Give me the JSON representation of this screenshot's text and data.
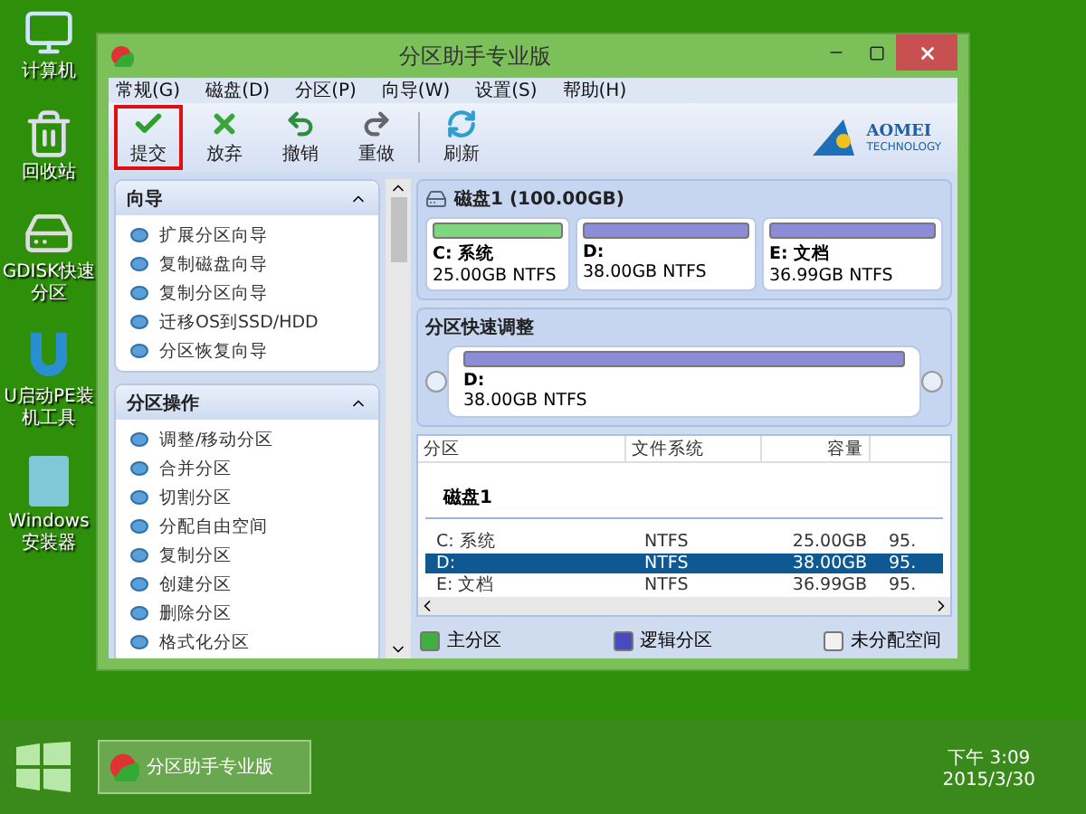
{
  "desktop_icons": [
    {
      "kind": "computer",
      "label": "计算机"
    },
    {
      "kind": "recycle",
      "label": "回收站"
    },
    {
      "kind": "gdisk",
      "label": "GDISK快速分区"
    },
    {
      "kind": "u",
      "label": "U启动PE装机工具"
    },
    {
      "kind": "windows",
      "label": "Windows安装器"
    }
  ],
  "window": {
    "title": "分区助手专业版",
    "menu": [
      "常规(G)",
      "磁盘(D)",
      "分区(P)",
      "向导(W)",
      "设置(S)",
      "帮助(H)"
    ],
    "toolbar": [
      {
        "kind": "check",
        "label": "提交",
        "selected": true
      },
      {
        "kind": "x",
        "label": "放弃",
        "selected": false
      },
      {
        "kind": "undo",
        "label": "撤销",
        "selected": false
      },
      {
        "kind": "redo",
        "label": "重做",
        "selected": false
      },
      {
        "kind": "refresh",
        "label": "刷新",
        "selected": false
      }
    ],
    "logo": {
      "name": "AOMEI",
      "tagline": "TECHNOLOGY"
    },
    "sidebar": [
      {
        "title": "向导",
        "expanded": true,
        "items": [
          "扩展分区向导",
          "复制磁盘向导",
          "复制分区向导",
          "迁移OS到SSD/HDD",
          "分区恢复向导"
        ]
      },
      {
        "title": "分区操作",
        "expanded": true,
        "items": [
          "调整/移动分区",
          "合并分区",
          "切割分区",
          "分配自由空间",
          "复制分区",
          "创建分区",
          "删除分区",
          "格式化分区"
        ]
      }
    ],
    "disk": {
      "title": "磁盘1 (100.00GB)",
      "partitions": [
        {
          "name": "C: 系统",
          "size": "25.00GB NTFS",
          "color": "#7fd67f"
        },
        {
          "name": "D:",
          "size": "38.00GB NTFS",
          "color": "#8c8cd8"
        },
        {
          "name": "E: 文档",
          "size": "36.99GB NTFS",
          "color": "#8c8cd8"
        }
      ]
    },
    "quick_adjust": {
      "title": "分区快速调整",
      "name": "D:",
      "size": "38.00GB NTFS"
    },
    "table": {
      "columns": [
        "分区",
        "文件系统",
        "容量"
      ],
      "group": "磁盘1",
      "rows": [
        {
          "cells": [
            "C: 系统",
            "NTFS",
            "25.00GB",
            "95."
          ],
          "selected": false
        },
        {
          "cells": [
            "D:",
            "NTFS",
            "38.00GB",
            "95."
          ],
          "selected": true
        },
        {
          "cells": [
            "E: 文档",
            "NTFS",
            "36.99GB",
            "95."
          ],
          "selected": false
        }
      ]
    },
    "legend": [
      {
        "label": "主分区",
        "color": "#3fb03f"
      },
      {
        "label": "逻辑分区",
        "color": "#4a4ac0"
      },
      {
        "label": "未分配空间",
        "color": "#f0f0f0"
      }
    ]
  },
  "taskbar": {
    "app": "分区助手专业版",
    "time": "下午 3:09",
    "date": "2015/3/30"
  }
}
